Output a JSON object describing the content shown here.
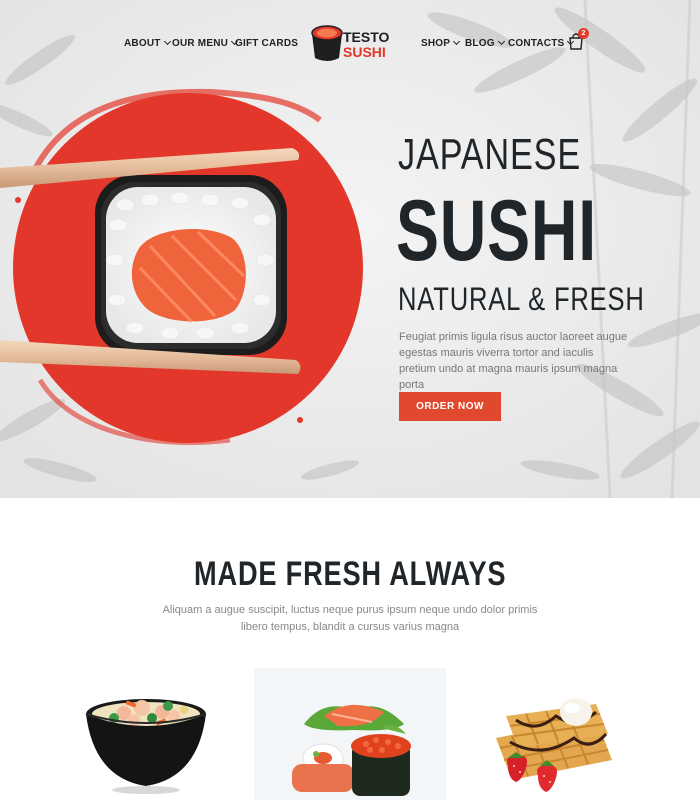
{
  "nav": {
    "left_items": [
      {
        "label": "ABOUT",
        "has_dropdown": true
      },
      {
        "label": "OUR MENU",
        "has_dropdown": true
      },
      {
        "label": "GIFT CARDS",
        "has_dropdown": false
      }
    ],
    "right_items": [
      {
        "label": "SHOP",
        "has_dropdown": true
      },
      {
        "label": "BLOG",
        "has_dropdown": true
      },
      {
        "label": "CONTACTS",
        "has_dropdown": true
      }
    ],
    "logo": {
      "line1": "TESTO",
      "line2": "SUSHI"
    },
    "cart": {
      "icon": "shopping-bag-icon",
      "count": "2"
    }
  },
  "hero": {
    "line1": "JAPANESE",
    "line2": "SUSHI",
    "line3": "NATURAL & FRESH",
    "description": "Feugiat primis ligula risus auctor laoreet augue egestas mauris viverra tortor and iaculis pretium undo at magna mauris ipsum magna porta",
    "cta_label": "ORDER NOW"
  },
  "section": {
    "title": "MADE FRESH ALWAYS",
    "description": "Aliquam a augue suscipit, luctus neque purus ipsum neque undo dolor primis libero tempus, blandit a cursus varius magna"
  },
  "cards": [
    {
      "image": "noodle-soup-bowl"
    },
    {
      "image": "sushi-assortment"
    },
    {
      "image": "waffles-dessert"
    }
  ],
  "colors": {
    "accent": "#e0492e",
    "hero_circle": "#e2372a",
    "heading": "#1f2529",
    "hero_bg": "#ececec",
    "card_highlight_bg": "#f3f6f8"
  }
}
